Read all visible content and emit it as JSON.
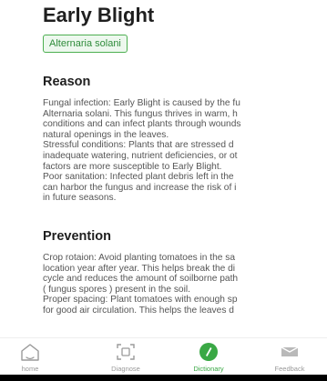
{
  "disease": {
    "title": "Early Blight",
    "scientific_name": "Alternaria solani"
  },
  "reason": {
    "heading": "Reason",
    "lines": [
      "Fungal infection: Early Blight is caused by the fu",
      "Alternaria solani. This fungus thrives in warm, h",
      "conditions and can infect plants through wounds",
      "natural openings in the leaves.",
      "Stressful conditions: Plants that are stressed d",
      "inadequate watering, nutrient deficiencies, or ot",
      "factors are more susceptible to Early Blight.",
      "Poor sanitation: Infected plant debris left in the",
      "can harbor the fungus and increase the risk of i",
      "in future seasons."
    ]
  },
  "prevention": {
    "heading": "Prevention",
    "lines": [
      "Crop rotaion: Avoid planting tomatoes in the sa",
      "location year after year. This helps break the di",
      "cycle and reduces the amount of soilborne path",
      "( fungus spores ) present in the soil.",
      "Proper spacing: Plant tomatoes with enough sp",
      "for good air circulation. This helps the leaves d"
    ]
  },
  "nav": {
    "items": [
      {
        "label": "home",
        "icon": "home-icon",
        "active": false
      },
      {
        "label": "Diagnose",
        "icon": "scan-icon",
        "active": false
      },
      {
        "label": "Dictionary",
        "icon": "compass-icon",
        "active": true
      },
      {
        "label": "Feedback",
        "icon": "mail-icon",
        "active": false
      }
    ]
  },
  "colors": {
    "accent": "#3aa845",
    "tag_border": "#4caf50",
    "tag_bg": "#edf8ee",
    "inactive": "#9a9a9a"
  }
}
